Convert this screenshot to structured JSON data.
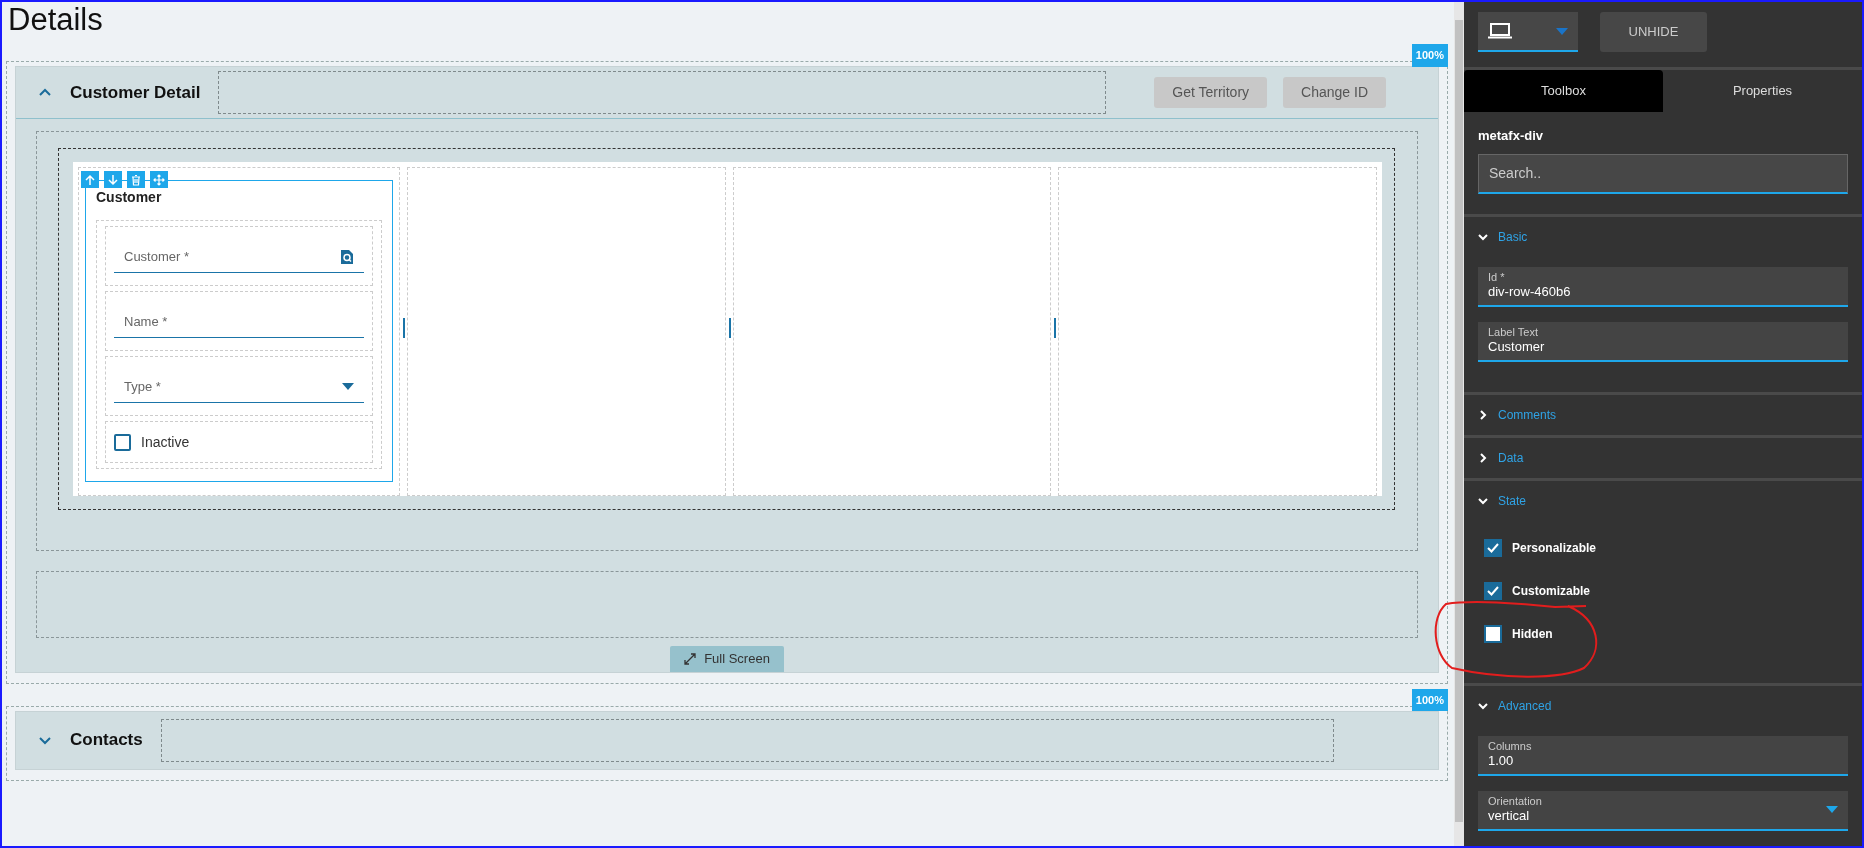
{
  "page": {
    "title": "Details"
  },
  "sections": [
    {
      "title": "Customer Detail",
      "expanded": true,
      "zoom_badge": "100%",
      "buttons": [
        "Get Territory",
        "Change ID"
      ],
      "card": {
        "title": "Customer",
        "selected": true,
        "fields": [
          {
            "kind": "lookup",
            "placeholder": "Customer *"
          },
          {
            "kind": "text",
            "placeholder": "Name *"
          },
          {
            "kind": "select",
            "placeholder": "Type *"
          },
          {
            "kind": "checkbox",
            "label": "Inactive",
            "checked": false
          }
        ]
      },
      "full_screen_button": "Full Screen"
    },
    {
      "title": "Contacts",
      "expanded": false,
      "zoom_badge": "100%"
    }
  ],
  "panel": {
    "unhide_button": "UNHIDE",
    "tabs": [
      {
        "label": "Toolbox",
        "selected": true
      },
      {
        "label": "Properties",
        "selected": false
      }
    ],
    "component_name": "metafx-div",
    "search": {
      "placeholder": "Search.."
    },
    "groups": [
      {
        "title": "Basic",
        "expanded": true,
        "items": [
          {
            "kind": "field",
            "label": "Id *",
            "value": "div-row-460b6"
          },
          {
            "kind": "field",
            "label": "Label Text",
            "value": "Customer"
          }
        ]
      },
      {
        "title": "Comments",
        "expanded": false
      },
      {
        "title": "Data",
        "expanded": false
      },
      {
        "title": "State",
        "expanded": true,
        "items": [
          {
            "kind": "checkbox",
            "label": "Personalizable",
            "checked": true
          },
          {
            "kind": "checkbox",
            "label": "Customizable",
            "checked": true
          },
          {
            "kind": "checkbox",
            "label": "Hidden",
            "checked": false
          }
        ]
      },
      {
        "title": "Advanced",
        "expanded": true,
        "items": [
          {
            "kind": "field",
            "label": "Columns",
            "value": "1.00"
          },
          {
            "kind": "select",
            "label": "Orientation",
            "value": "vertical"
          }
        ]
      }
    ]
  }
}
